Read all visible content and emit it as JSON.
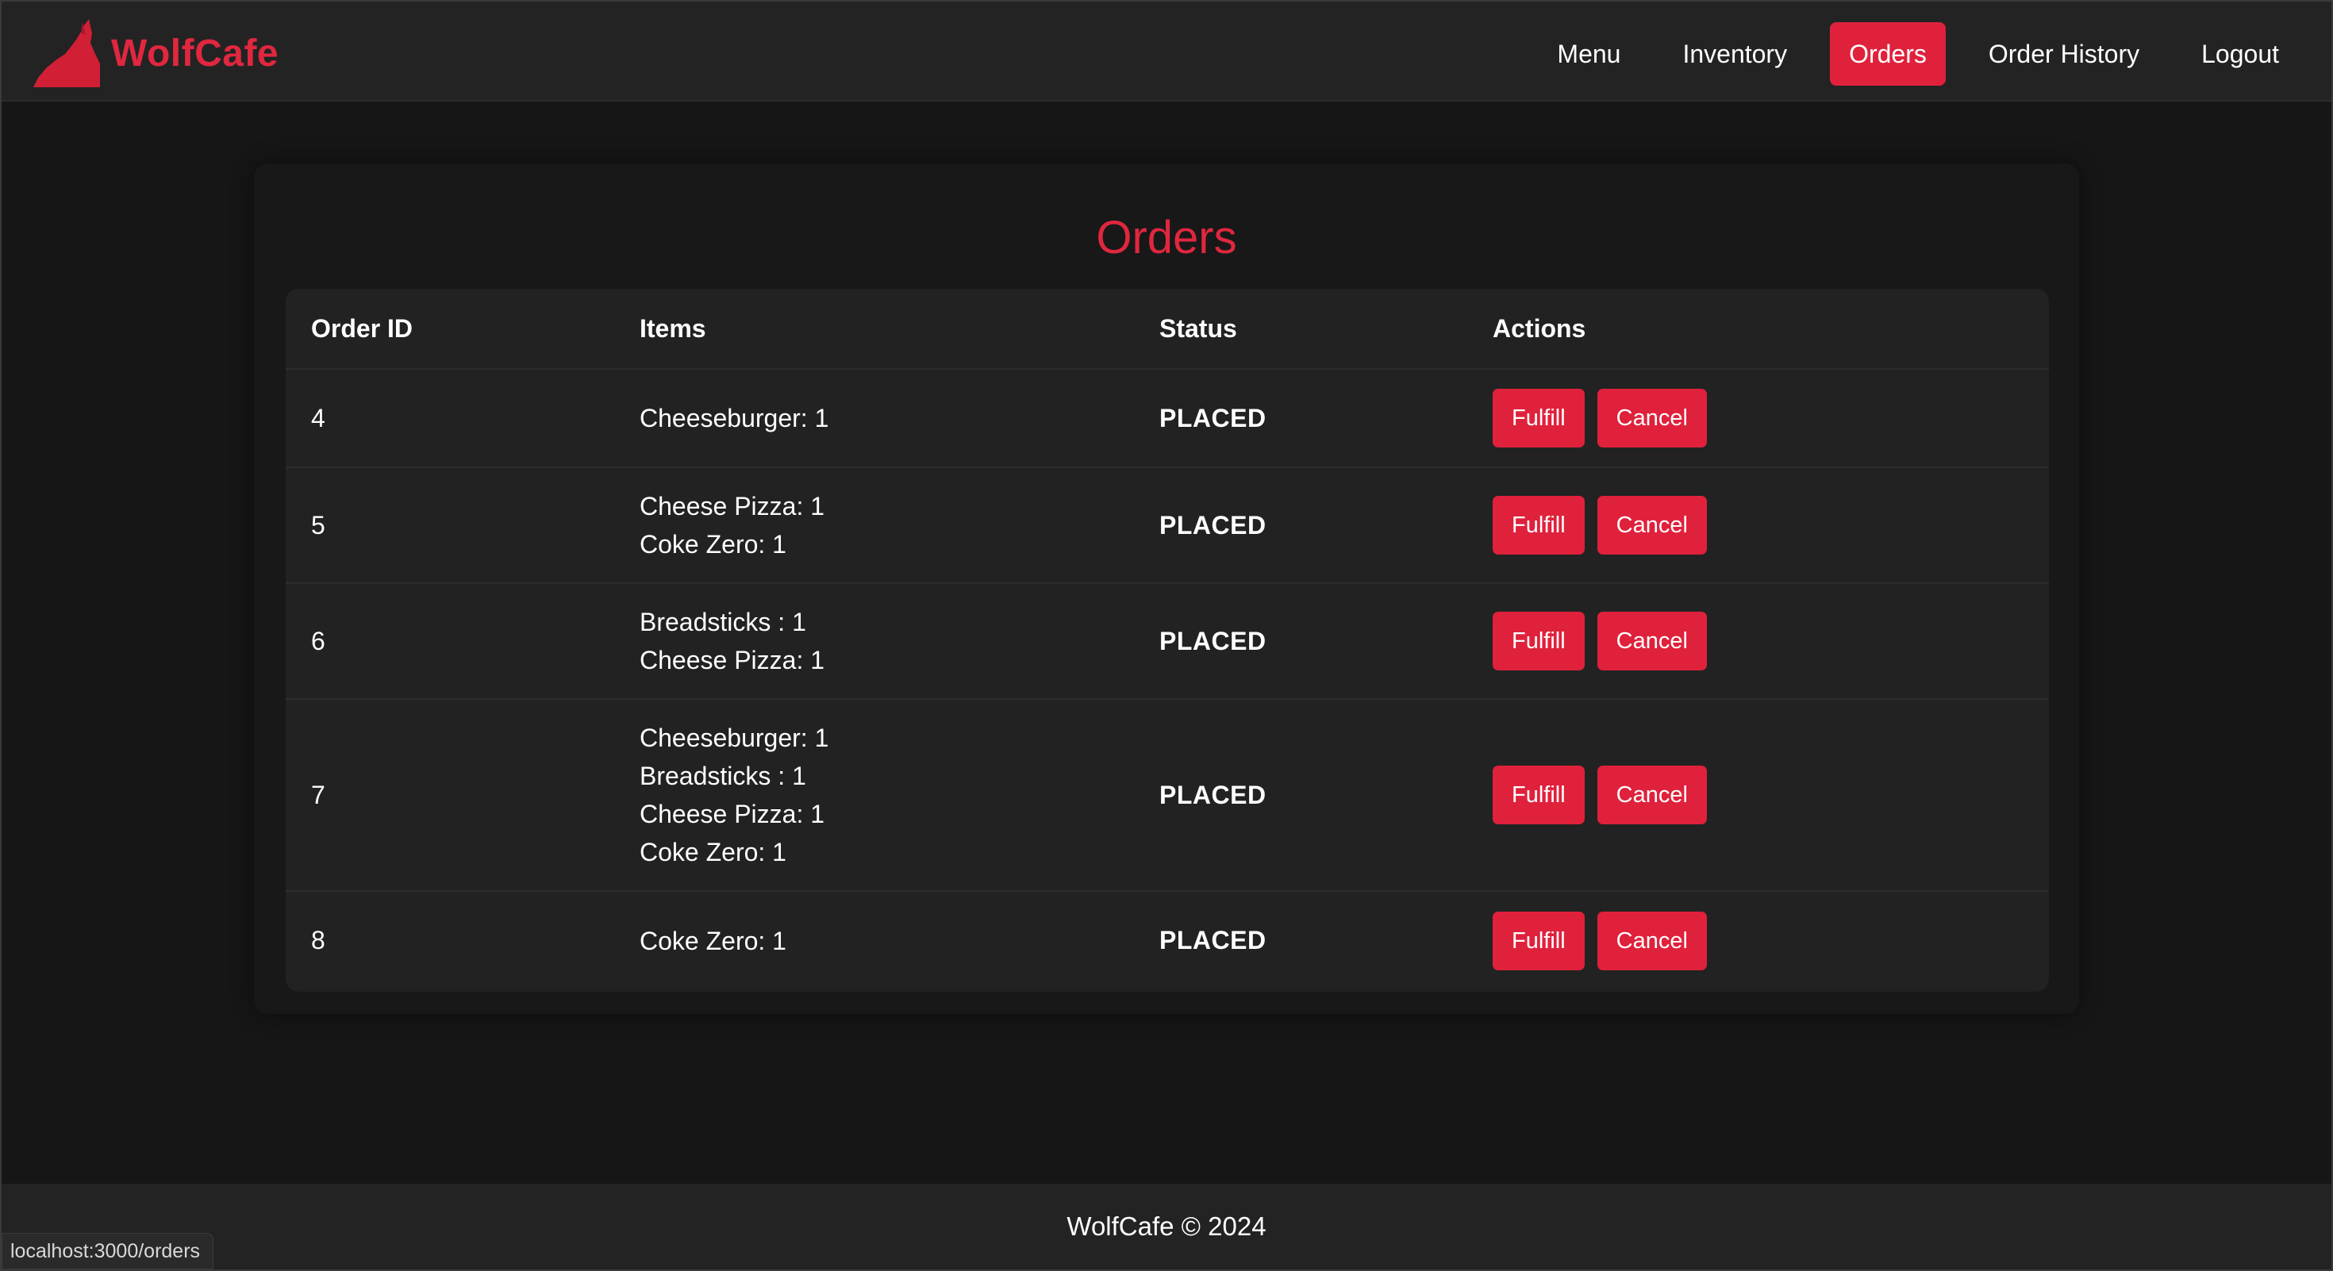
{
  "brand": {
    "name": "WolfCafe",
    "logo_icon": "wolf-howling-icon",
    "accent_color": "#e0273f"
  },
  "nav": {
    "items": [
      {
        "label": "Menu",
        "active": false
      },
      {
        "label": "Inventory",
        "active": false
      },
      {
        "label": "Orders",
        "active": true
      },
      {
        "label": "Order History",
        "active": false
      },
      {
        "label": "Logout",
        "active": false
      }
    ]
  },
  "page": {
    "title": "Orders"
  },
  "table": {
    "headers": {
      "order_id": "Order ID",
      "items": "Items",
      "status": "Status",
      "actions": "Actions"
    },
    "rows": [
      {
        "id": "4",
        "items": [
          "Cheeseburger: 1"
        ],
        "status": "PLACED"
      },
      {
        "id": "5",
        "items": [
          "Cheese Pizza: 1",
          "Coke Zero: 1"
        ],
        "status": "PLACED"
      },
      {
        "id": "6",
        "items": [
          "Breadsticks : 1",
          "Cheese Pizza: 1"
        ],
        "status": "PLACED"
      },
      {
        "id": "7",
        "items": [
          "Cheeseburger: 1",
          "Breadsticks : 1",
          "Cheese Pizza: 1",
          "Coke Zero: 1"
        ],
        "status": "PLACED"
      },
      {
        "id": "8",
        "items": [
          "Coke Zero: 1"
        ],
        "status": "PLACED"
      }
    ],
    "actions": {
      "fulfill_label": "Fulfill",
      "cancel_label": "Cancel"
    }
  },
  "footer": {
    "text": "WolfCafe © 2024"
  },
  "status_bar": {
    "url": "localhost:3000/orders"
  }
}
